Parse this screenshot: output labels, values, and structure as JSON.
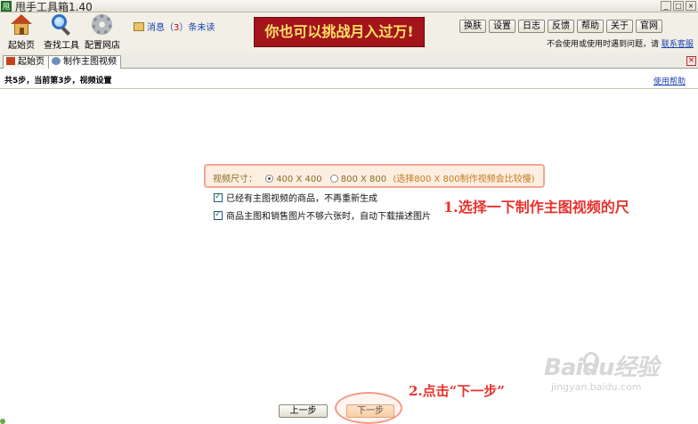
{
  "window": {
    "title": "甩手工具箱1.40",
    "app_icon": "甩",
    "controls": [
      "minimize-icon",
      "maximize-icon",
      "close-icon"
    ]
  },
  "toolbar": {
    "tools": [
      {
        "label": "起始页",
        "icon": "home-icon"
      },
      {
        "label": "查找工具",
        "icon": "magnifier-icon"
      },
      {
        "label": "配置网店",
        "icon": "gear-icon"
      }
    ],
    "message": {
      "prefix": "消息（",
      "count": "3",
      "suffix": "）条未读",
      "icon": "mail-icon"
    },
    "banner": "你也可以挑战月入过万!",
    "buttons": [
      "换肤",
      "设置",
      "日志",
      "反馈",
      "帮助",
      "关于",
      "官网"
    ],
    "help_text": "不会使用或使用时遇到问题，请",
    "help_link": "联系客服"
  },
  "tabs": [
    {
      "label": "起始页",
      "icon": "home-icon",
      "active": false
    },
    {
      "label": "制作主图视频",
      "icon": "video-icon",
      "active": true
    }
  ],
  "step_header": {
    "text": "共5步，当前第3步，视频设置",
    "help_link": "使用帮助"
  },
  "video_settings": {
    "size_label": "视频尺寸：",
    "options": [
      {
        "label": "400 X 400",
        "selected": true
      },
      {
        "label": "800 X 800",
        "selected": false
      }
    ],
    "note": "(选择800 X 800制作视频会比较慢)",
    "checkboxes": [
      {
        "label": "已经有主图视频的商品，不再重新生成",
        "checked": true
      },
      {
        "label": "商品主图和销售图片不够六张时，自动下载描述图片",
        "checked": true
      }
    ]
  },
  "annotations": {
    "step1": "1.选择一下制作主图视频的尺",
    "step2": "2.点击“下一步”"
  },
  "navigation": {
    "prev_label": "上一步",
    "next_label": "下一步"
  },
  "watermark": {
    "main": "Baidu经验",
    "url": "jingyan.baidu.com"
  },
  "colors": {
    "annotation_red": "#e8322d",
    "banner_bg": "#a3141b",
    "banner_text": "#ffe066",
    "highlight_border": "#f3a693",
    "link_blue": "#1a3fb0"
  }
}
